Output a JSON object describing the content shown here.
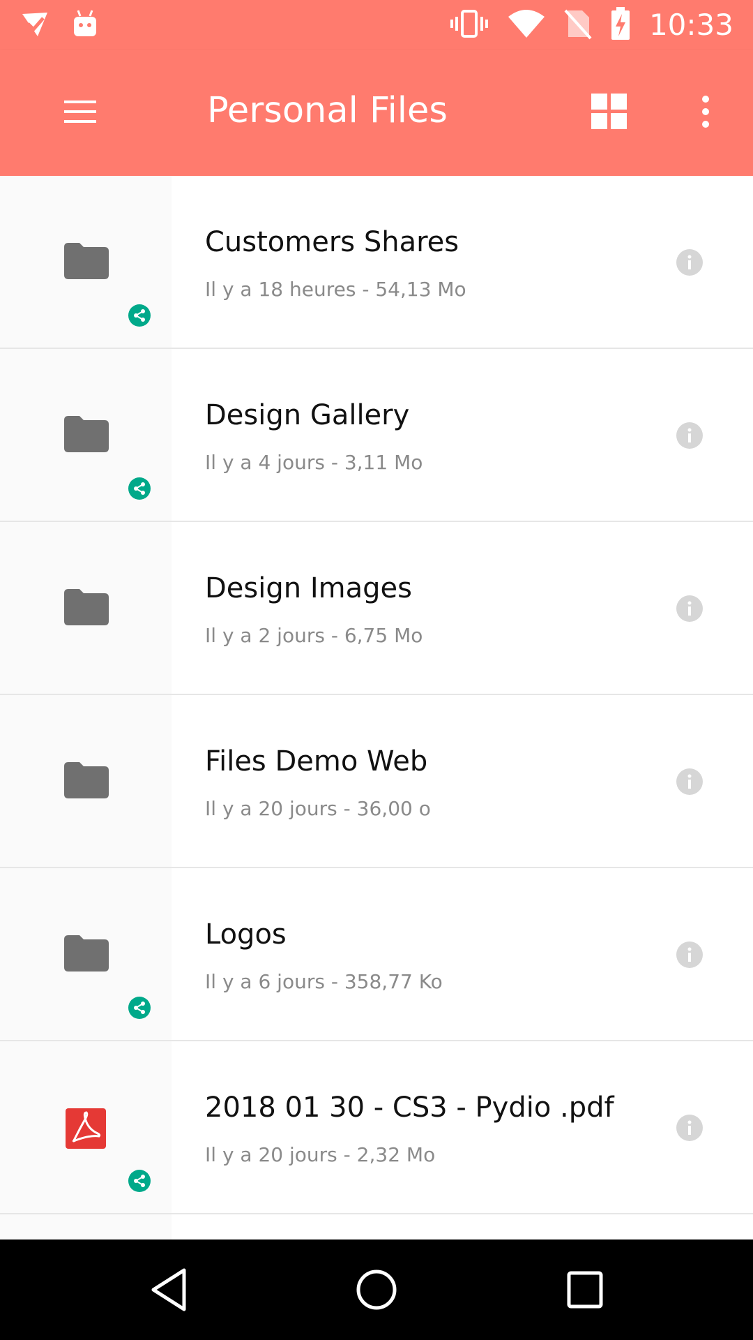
{
  "status_bar": {
    "time": "10:33",
    "left_icons": [
      "check-notification-icon",
      "android-robot-icon"
    ],
    "right_icons": [
      "vibrate-icon",
      "wifi-icon",
      "no-sim-icon",
      "battery-charging-icon"
    ]
  },
  "app_bar": {
    "title": "Personal Files",
    "color": "#ff7b6e"
  },
  "files": [
    {
      "name": "Customers Shares",
      "time": "Il y a 18 heures",
      "size": "54,13 Mo",
      "type": "folder",
      "shared": true
    },
    {
      "name": "Design Gallery",
      "time": "Il y a 4 jours",
      "size": "3,11 Mo",
      "type": "folder",
      "shared": true
    },
    {
      "name": "Design Images",
      "time": "Il y a 2 jours",
      "size": "6,75 Mo",
      "type": "folder",
      "shared": false
    },
    {
      "name": "Files Demo Web",
      "time": "Il y a 20 jours",
      "size": "36,00 o",
      "type": "folder",
      "shared": false
    },
    {
      "name": "Logos",
      "time": "Il y a 6 jours",
      "size": "358,77 Ko",
      "type": "folder",
      "shared": true
    },
    {
      "name": "2018 01 30 - CS3 - Pydio .pdf",
      "time": "Il y a 20 jours",
      "size": "2,32 Mo",
      "type": "pdf",
      "shared": true
    }
  ],
  "meta_separator": "  -  ",
  "colors": {
    "accent": "#ff7b6e",
    "share_badge": "#00a98a",
    "pdf": "#e53935",
    "folder": "#707070"
  }
}
